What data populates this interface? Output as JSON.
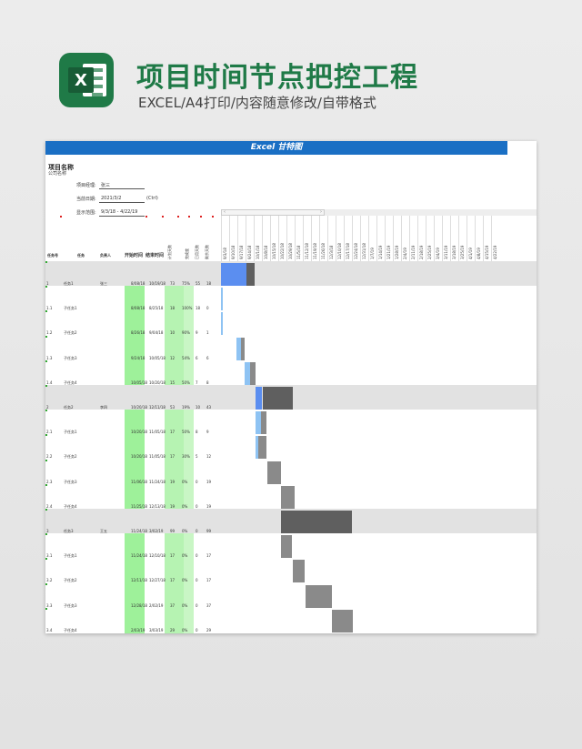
{
  "header": {
    "icon_letter": "X",
    "title": "项目时间节点把控工程",
    "subtitle": "EXCEL/A4打印/内容随意修改/自带格式"
  },
  "sheet": {
    "banner": "Excel 甘特图",
    "project_name": "项目名称",
    "company": "公司名称",
    "manager_label": "项目经理:",
    "manager_value": "张三",
    "current_date_label": "当前日期:",
    "current_date_value": "2021/3/2",
    "current_date_note": "(Ctrl)",
    "display_range_label": "显示范围:",
    "display_range_value": "9/3/18 - 4/22/19",
    "scroll_left": "‹",
    "scroll_right": "›",
    "columns": {
      "num": "任务号",
      "task": "任务",
      "owner": "负责人",
      "start": "开始时间",
      "end": "结束时间",
      "plan_days": "计划天数",
      "done": "完成度",
      "used_days": "已用天数",
      "remaining_days": "剩余天数"
    },
    "date_headers": [
      "9/3/18",
      "9/10/18",
      "9/17/18",
      "9/24/18",
      "10/1/18",
      "10/8/18",
      "10/15/18",
      "10/22/18",
      "10/29/18",
      "11/5/18",
      "11/12/18",
      "11/19/18",
      "11/26/18",
      "12/3/18",
      "12/10/18",
      "12/17/18",
      "12/24/18",
      "12/31/18",
      "1/7/19",
      "1/14/19",
      "1/21/19",
      "1/28/19",
      "2/4/19",
      "2/11/19",
      "2/18/19",
      "2/25/19",
      "3/4/19",
      "3/11/19",
      "3/18/19",
      "3/25/19",
      "4/1/19",
      "4/8/19",
      "4/15/19",
      "4/22/19"
    ],
    "rows": [
      {
        "num": "1",
        "task": "任务1",
        "owner": "张三",
        "start": "8/08/18",
        "end": "10/19/18",
        "plan": "73",
        "done": "75%",
        "used": "55",
        "remain": "18",
        "summary": true
      },
      {
        "num": "1.1",
        "task": "子任务1",
        "owner": "",
        "start": "8/08/18",
        "end": "8/25/18",
        "plan": "18",
        "done": "100%",
        "used": "18",
        "remain": "0",
        "summary": false
      },
      {
        "num": "1.2",
        "task": "子任务2",
        "owner": "",
        "start": "8/26/18",
        "end": "9/04/18",
        "plan": "10",
        "done": "90%",
        "used": "9",
        "remain": "1",
        "summary": false
      },
      {
        "num": "1.3",
        "task": "子任务3",
        "owner": "",
        "start": "9/24/18",
        "end": "10/05/18",
        "plan": "12",
        "done": "54%",
        "used": "6",
        "remain": "6",
        "summary": false
      },
      {
        "num": "1.4",
        "task": "子任务4",
        "owner": "",
        "start": "10/05/18",
        "end": "10/20/18",
        "plan": "15",
        "done": "50%",
        "used": "7",
        "remain": "8",
        "summary": false
      },
      {
        "num": "2",
        "task": "任务2",
        "owner": "李四",
        "start": "10/20/18",
        "end": "12/11/18",
        "plan": "53",
        "done": "19%",
        "used": "10",
        "remain": "43",
        "summary": true
      },
      {
        "num": "2.1",
        "task": "子任务1",
        "owner": "",
        "start": "10/20/18",
        "end": "11/05/18",
        "plan": "17",
        "done": "50%",
        "used": "8",
        "remain": "9",
        "summary": false
      },
      {
        "num": "2.2",
        "task": "子任务2",
        "owner": "",
        "start": "10/20/18",
        "end": "11/05/18",
        "plan": "17",
        "done": "30%",
        "used": "5",
        "remain": "12",
        "summary": false
      },
      {
        "num": "2.3",
        "task": "子任务3",
        "owner": "",
        "start": "11/06/18",
        "end": "11/24/18",
        "plan": "19",
        "done": "0%",
        "used": "0",
        "remain": "19",
        "summary": false
      },
      {
        "num": "2.4",
        "task": "子任务4",
        "owner": "",
        "start": "11/25/18",
        "end": "12/13/18",
        "plan": "19",
        "done": "0%",
        "used": "0",
        "remain": "19",
        "summary": false
      },
      {
        "num": "3",
        "task": "任务3",
        "owner": "王五",
        "start": "11/24/18",
        "end": "3/02/19",
        "plan": "99",
        "done": "0%",
        "used": "0",
        "remain": "99",
        "summary": true
      },
      {
        "num": "3.1",
        "task": "子任务1",
        "owner": "",
        "start": "11/24/18",
        "end": "12/10/18",
        "plan": "17",
        "done": "0%",
        "used": "0",
        "remain": "17",
        "summary": false
      },
      {
        "num": "3.2",
        "task": "子任务2",
        "owner": "",
        "start": "12/11/18",
        "end": "12/27/18",
        "plan": "17",
        "done": "0%",
        "used": "0",
        "remain": "17",
        "summary": false
      },
      {
        "num": "3.3",
        "task": "子任务3",
        "owner": "",
        "start": "12/28/18",
        "end": "2/02/19",
        "plan": "37",
        "done": "0%",
        "used": "0",
        "remain": "37",
        "summary": false
      },
      {
        "num": "3.4",
        "task": "子任务4",
        "owner": "",
        "start": "2/03/19",
        "end": "3/03/19",
        "plan": "29",
        "done": "0%",
        "used": "0",
        "remain": "29",
        "summary": false
      }
    ]
  },
  "colors": {
    "accent": "#1f7a47",
    "banner": "#1a6fc4",
    "bar_done": "#5b8ef0",
    "bar_done_light": "#8ec3f3",
    "bar_remain": "#5f5f5f",
    "bar_remain_light": "#8a8a8a"
  }
}
